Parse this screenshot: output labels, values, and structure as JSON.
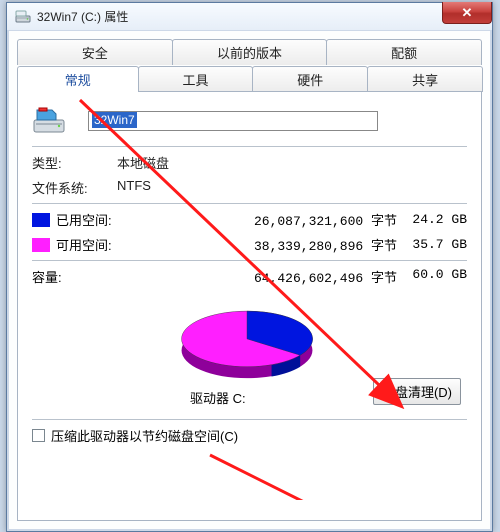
{
  "window": {
    "title": "32Win7  (C:) 属性",
    "close_glyph": "✕"
  },
  "tabs": {
    "security": "安全",
    "previous": "以前的版本",
    "quota": "配额",
    "general": "常规",
    "tools": "工具",
    "hardware": "硬件",
    "sharing": "共享",
    "active": "general"
  },
  "general": {
    "name_value": "32Win7",
    "type_label": "类型:",
    "type_value": "本地磁盘",
    "fs_label": "文件系统:",
    "fs_value": "NTFS",
    "used_label": "已用空间:",
    "used_bytes": "26,087,321,600 字节",
    "used_gb": "24.2 GB",
    "free_label": "可用空间:",
    "free_bytes": "38,339,280,896 字节",
    "free_gb": "35.7 GB",
    "capacity_label": "容量:",
    "capacity_bytes": "64,426,602,496 字节",
    "capacity_gb": "60.0 GB",
    "drive_label": "驱动器 C:",
    "cleanup_button": "磁盘清理(D)",
    "compress_checkbox": "压缩此驱动器以节约磁盘空间(C)"
  },
  "colors": {
    "used": "#0015e0",
    "free": "#ff1fff",
    "pie_side": "#8e009a"
  },
  "chart_data": {
    "type": "pie",
    "title": "驱动器 C:",
    "series": [
      {
        "name": "已用空间",
        "value": 24.2,
        "unit": "GB",
        "color": "#0015e0"
      },
      {
        "name": "可用空间",
        "value": 35.7,
        "unit": "GB",
        "color": "#ff1fff"
      }
    ],
    "total": 60.0
  }
}
